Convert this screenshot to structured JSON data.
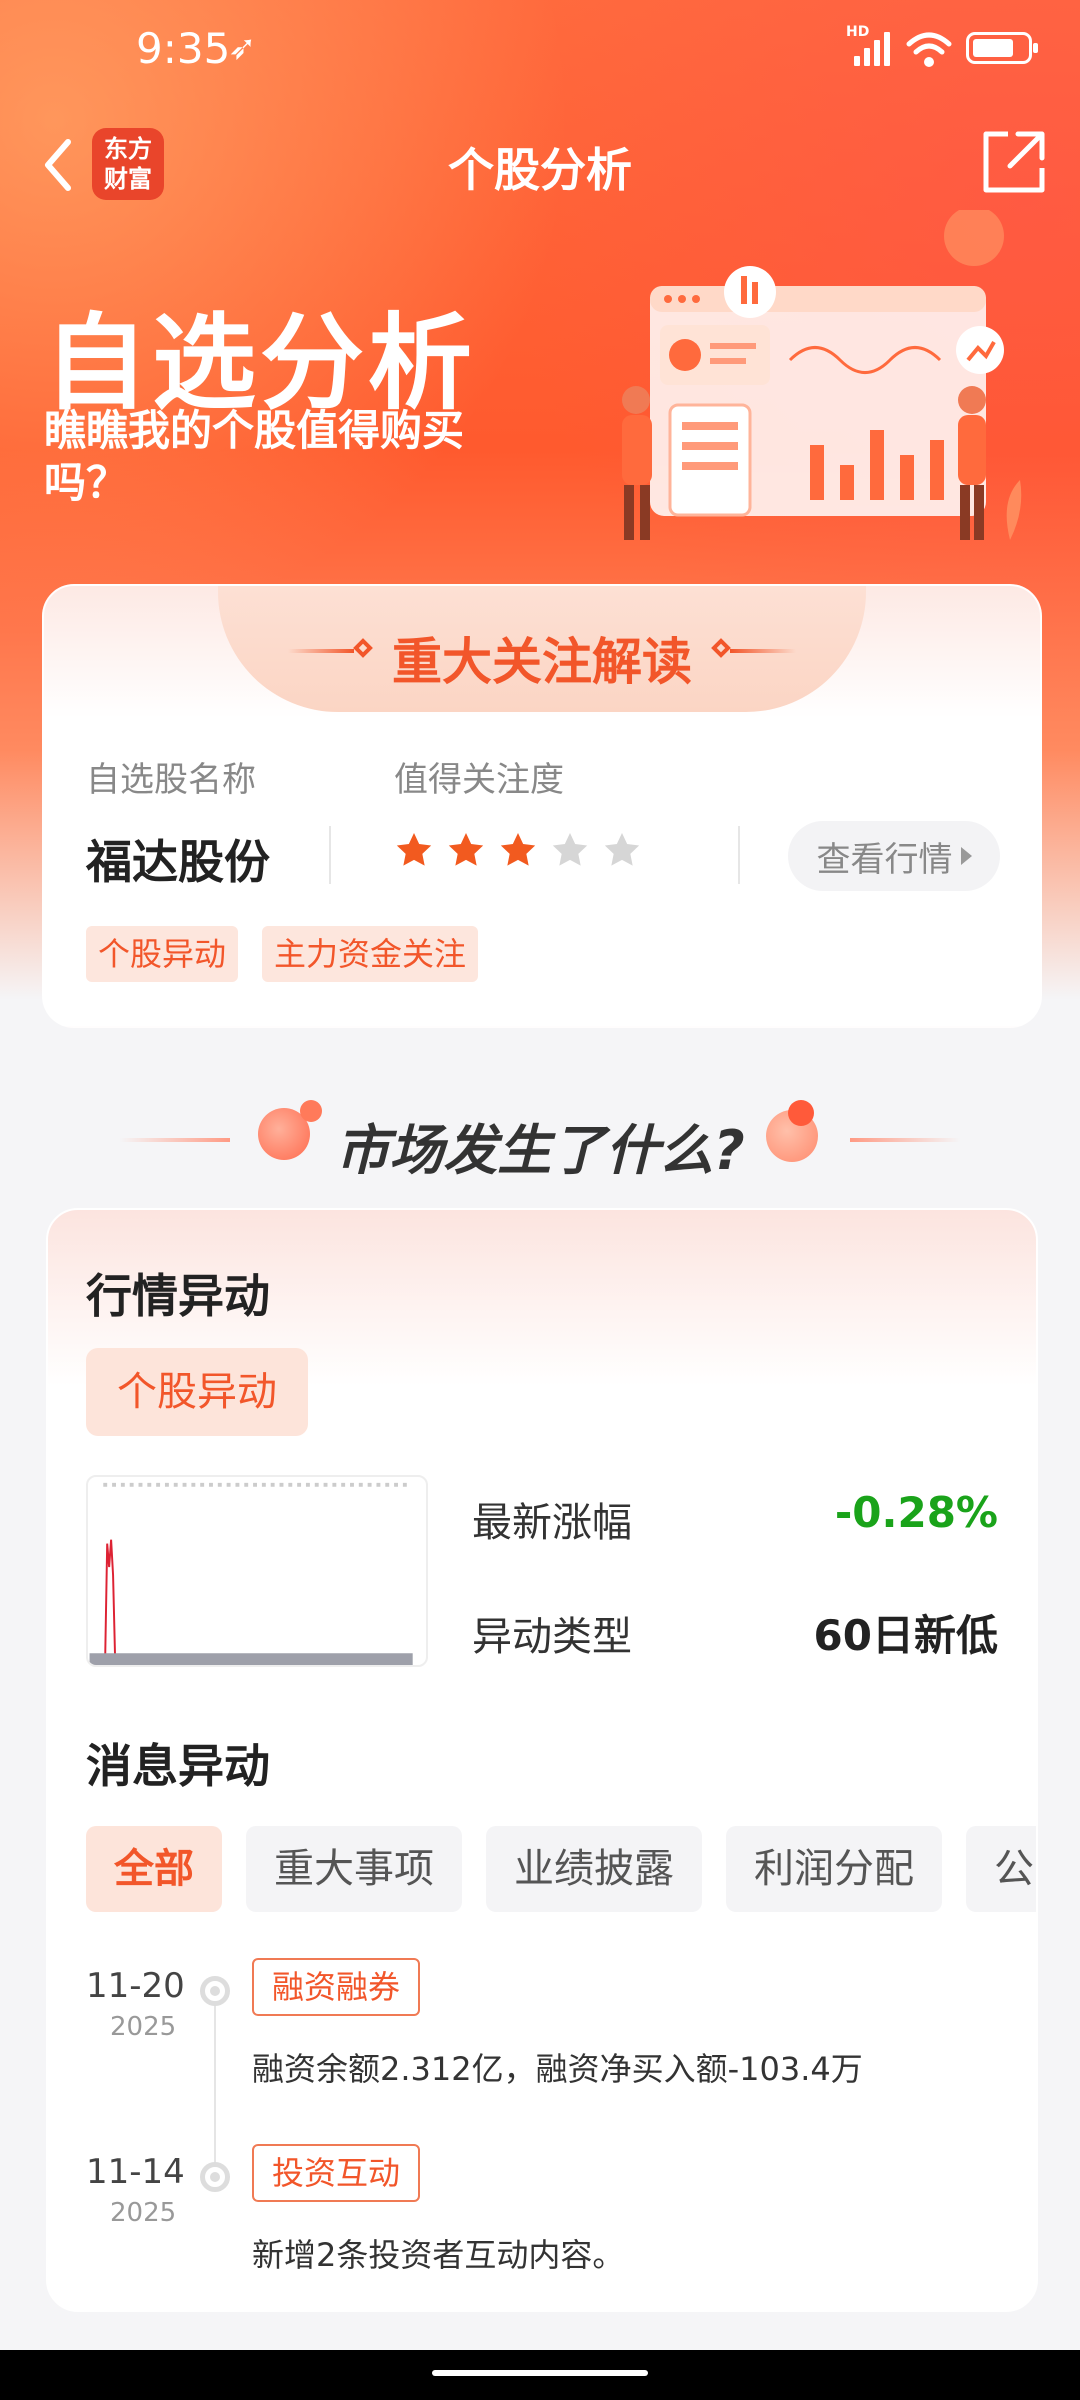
{
  "status_bar": {
    "time": "9:35",
    "network": "HD"
  },
  "nav": {
    "title": "个股分析",
    "logo_line1": "东方",
    "logo_line2": "财富"
  },
  "hero": {
    "title": "自选分析",
    "subtitle": "瞧瞧我的个股值得购买吗？"
  },
  "focus_card": {
    "title": "重大关注解读",
    "name_label": "自选股名称",
    "attention_label": "值得关注度",
    "stock_name": "福达股份",
    "rating": 3,
    "rating_max": 5,
    "view_quote_label": "查看行情",
    "tags": [
      "个股异动",
      "主力资金关注"
    ]
  },
  "section": {
    "title": "市场发生了什么?"
  },
  "market_card": {
    "title": "行情异动",
    "tag": "个股异动",
    "rows": [
      {
        "label": "最新涨幅",
        "value": "-0.28%"
      },
      {
        "label": "异动类型",
        "value": "60日新低"
      }
    ],
    "news_title": "消息异动",
    "filters": [
      "全部",
      "重大事项",
      "业绩披露",
      "利润分配",
      "公司"
    ],
    "active_filter": 0,
    "timeline": [
      {
        "date": "11-20",
        "year": "2025",
        "tag": "融资融券",
        "text": "融资余额2.312亿，融资净买入额-103.4万"
      },
      {
        "date": "11-14",
        "year": "2025",
        "tag": "投资互动",
        "text": "新增2条投资者互动内容。"
      }
    ]
  },
  "colors": {
    "accent": "#f2562a",
    "up_down_green": "#1aa31a",
    "star_on": "#f25a1f",
    "star_off": "#d6d6d6"
  }
}
